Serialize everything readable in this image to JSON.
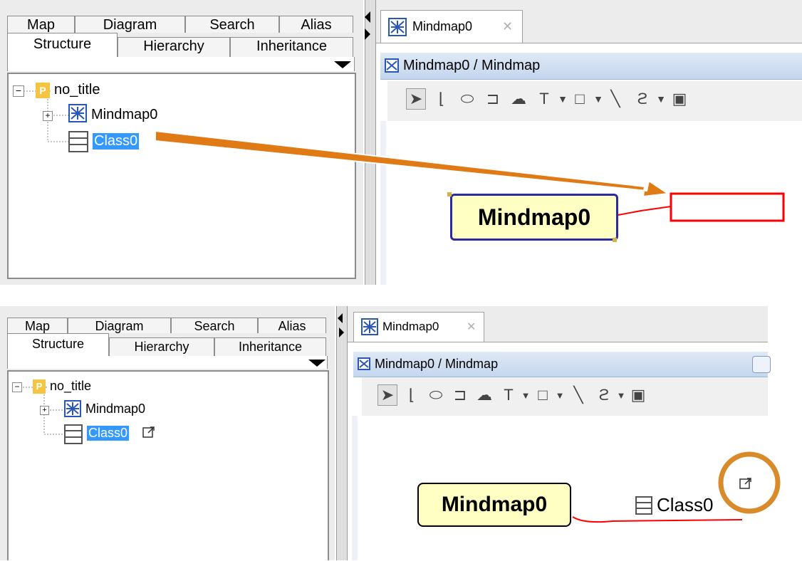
{
  "top": {
    "tabs_row1": [
      "Map",
      "Diagram",
      "Search",
      "Alias"
    ],
    "tabs_row2": [
      "Structure",
      "Hierarchy",
      "Inheritance"
    ],
    "tree": {
      "root": "no_title",
      "child1": "Mindmap0",
      "child2": "Class0"
    },
    "editor_tab": "Mindmap0",
    "breadcrumb": "Mindmap0 / Mindmap",
    "topic_label": "Mindmap0"
  },
  "bottom": {
    "tabs_row1": [
      "Map",
      "Diagram",
      "Search",
      "Alias"
    ],
    "tabs_row2": [
      "Structure",
      "Hierarchy",
      "Inheritance"
    ],
    "tree": {
      "root": "no_title",
      "child1": "Mindmap0",
      "child2": "Class0"
    },
    "editor_tab": "Mindmap0",
    "breadcrumb": "Mindmap0 / Mindmap",
    "topic_label": "Mindmap0",
    "linked_label": "Class0"
  },
  "colors": {
    "arrow": "#e07a14",
    "highlight_circle": "#d98a2b",
    "link_line": "#ff0000",
    "selection": "#3399ff"
  }
}
